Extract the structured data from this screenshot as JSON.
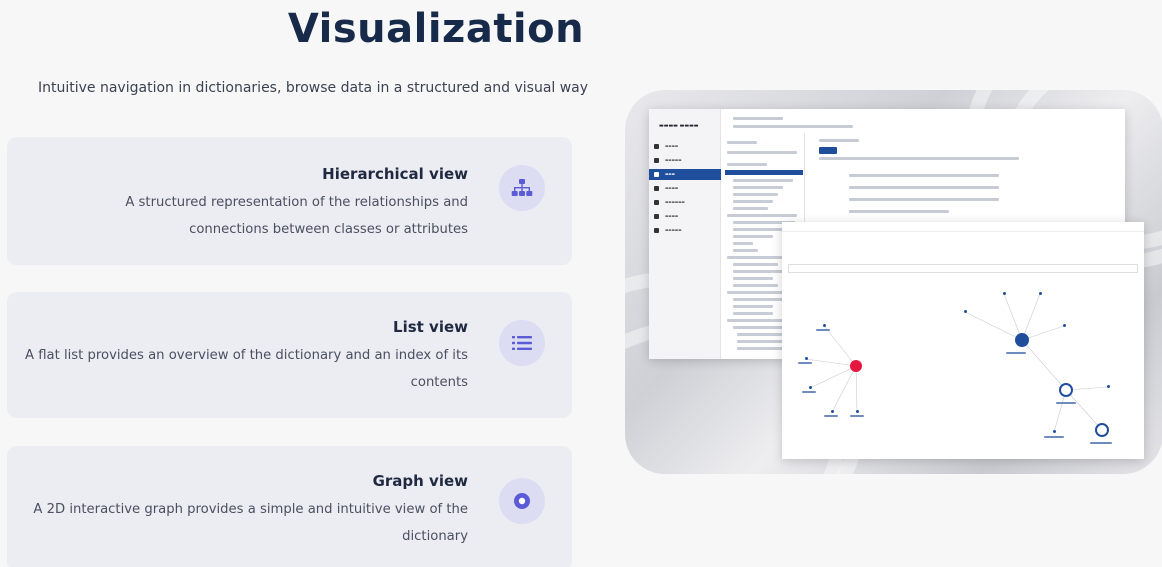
{
  "page": {
    "title": "Visualization",
    "subtitle": "Intuitive navigation in dictionaries, browse data in a structured and visual way"
  },
  "cards": [
    {
      "title": "Hierarchical view",
      "description": "A structured representation of the relationships and connections between classes or attributes",
      "icon": "hierarchy-icon"
    },
    {
      "title": "List view",
      "description": "A flat list provides an overview of the dictionary and an index of its contents",
      "icon": "list-icon"
    },
    {
      "title": "Graph view",
      "description": "A 2D interactive graph provides a simple and intuitive view of the dictionary",
      "icon": "graph-icon"
    }
  ],
  "colors": {
    "accent": "#5b5bd6",
    "accent_soft": "#dcdcf3",
    "card_bg": "#ececf3",
    "title": "#172a4a",
    "node_red": "#e5173f",
    "node_blue": "#1f4f9c"
  },
  "mockup": {
    "description_icon": "app-screenshot-image"
  }
}
